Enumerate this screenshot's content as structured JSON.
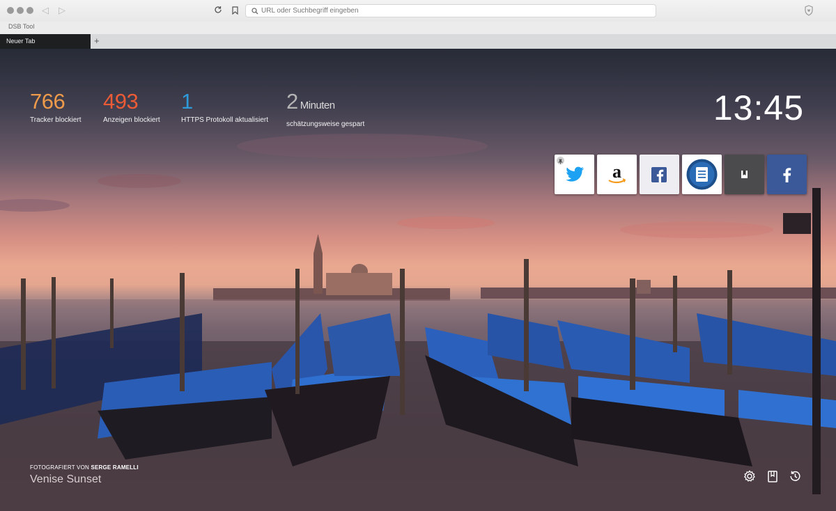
{
  "browser": {
    "url_placeholder": "URL oder Suchbegriff eingeben",
    "bookmarks": [
      "DSB Tool"
    ],
    "tabs": [
      {
        "label": "Neuer Tab",
        "active": true
      }
    ],
    "new_tab_symbol": "+"
  },
  "stats": [
    {
      "value": "766",
      "unit": "",
      "label": "Tracker blockiert",
      "color": "#ee9a4b"
    },
    {
      "value": "493",
      "unit": "",
      "label": "Anzeigen blockiert",
      "color": "#ea5b36"
    },
    {
      "value": "1",
      "unit": "",
      "label": "HTTPS Protokoll aktualisiert",
      "color": "#2f9ad8"
    },
    {
      "value": "2",
      "unit": "Minuten",
      "label": "schätzungsweise gespart",
      "color": "#b3b3b3"
    }
  ],
  "clock": "13:45",
  "top_sites": [
    {
      "name": "twitter-icon",
      "bg": "#ffffff",
      "pinned": true
    },
    {
      "name": "amazon-icon",
      "bg": "#ffffff",
      "pinned": false
    },
    {
      "name": "facebook-icon",
      "bg": "#eeeef2",
      "pinned": false
    },
    {
      "name": "notes-icon",
      "bg": "#ffffff",
      "pinned": false
    },
    {
      "name": "bookmark-site-icon",
      "bg": "#4b4b4d",
      "pinned": false
    },
    {
      "name": "facebook-icon",
      "bg": "#3b5998",
      "pinned": false
    }
  ],
  "photo": {
    "credit_prefix": "FOTOGRAFIERT VON",
    "photographer": "SERGE RAMELLI",
    "title": "Venise Sunset"
  },
  "footer_icons": [
    "settings-icon",
    "bookmarks-icon",
    "history-icon"
  ]
}
